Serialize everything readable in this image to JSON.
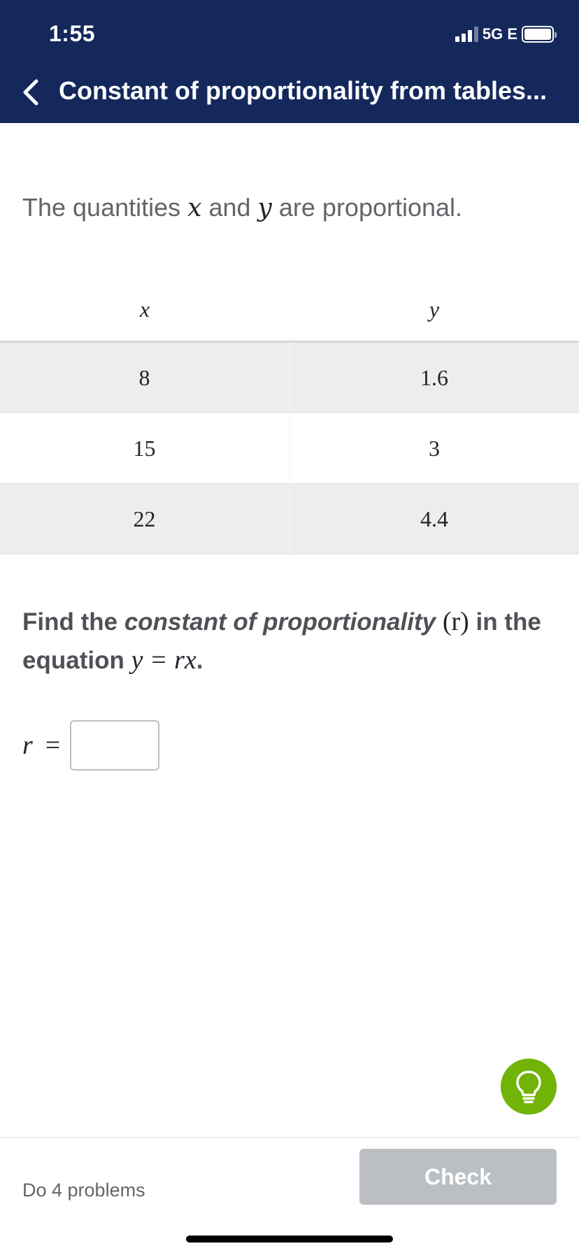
{
  "status_bar": {
    "time": "1:55",
    "network": "5G E"
  },
  "header": {
    "title": "Constant of proportionality from tables..."
  },
  "prompt": {
    "before": "The quantities ",
    "var1": "x",
    "middle": " and ",
    "var2": "y",
    "after": " are proportional."
  },
  "table": {
    "headers": [
      "x",
      "y"
    ],
    "rows": [
      [
        "8",
        "1.6"
      ],
      [
        "15",
        "3"
      ],
      [
        "22",
        "4.4"
      ]
    ]
  },
  "question": {
    "part1": "Find the ",
    "emphasis": "constant of proportionality",
    "space": " ",
    "var_paren": "(r)",
    "part2": " in the equation ",
    "equation": "y = rx",
    "period": "."
  },
  "answer": {
    "label": "r",
    "equals": "=",
    "value": ""
  },
  "footer": {
    "problems": "Do 4 problems",
    "check_label": "Check"
  },
  "colors": {
    "header_bg": "#14285c",
    "hint_green": "#71b307",
    "check_disabled": "#bbbfc3"
  }
}
